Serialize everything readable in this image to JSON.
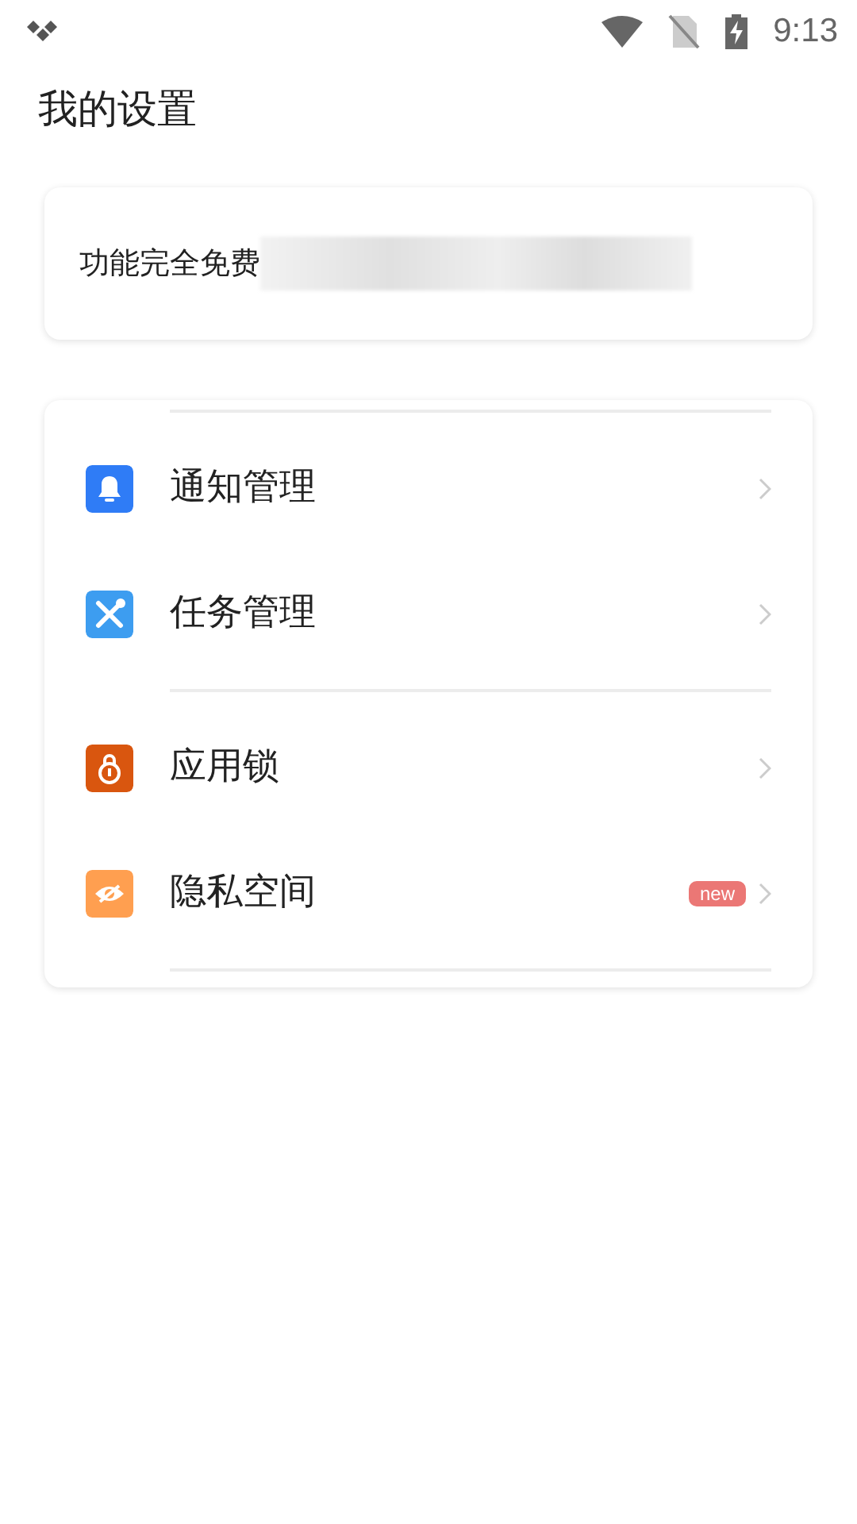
{
  "status_bar": {
    "time": "9:13"
  },
  "title": "我的设置",
  "promo": {
    "text": "功能完全免费"
  },
  "menu": {
    "groups": [
      {
        "items": [
          {
            "label": "通知管理",
            "kind": "bell",
            "color": "#2f7cf6"
          },
          {
            "label": "任务管理",
            "kind": "tools",
            "color": "#3d9df0"
          }
        ]
      },
      {
        "items": [
          {
            "label": "应用锁",
            "kind": "lock",
            "color": "#d9560f"
          },
          {
            "label": "隐私空间",
            "kind": "eye",
            "color": "#ff9f50",
            "badge": "new"
          }
        ]
      }
    ]
  }
}
